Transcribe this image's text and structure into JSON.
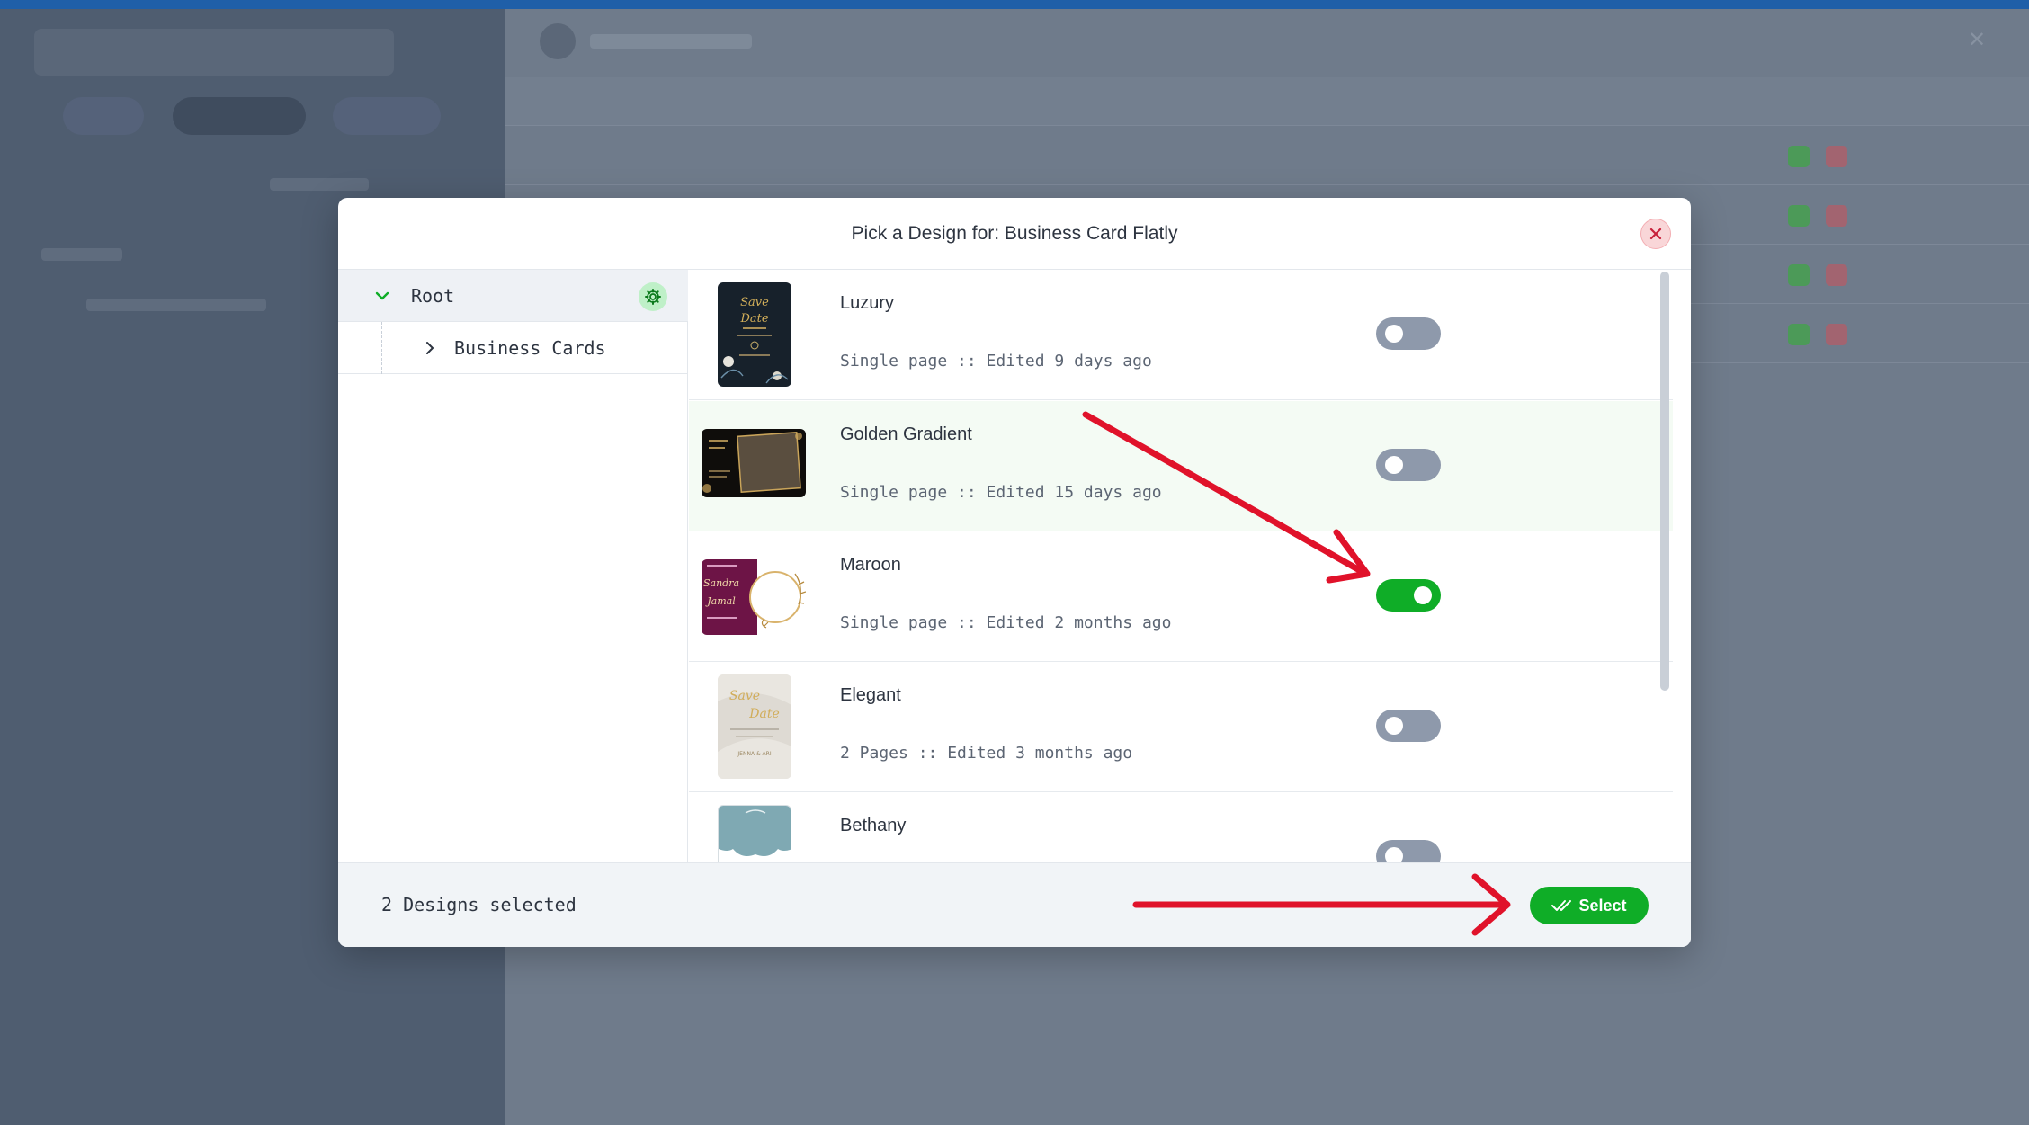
{
  "modal": {
    "title": "Pick a Design for: Business Card Flatly",
    "close_icon": "close-icon"
  },
  "tree": {
    "root_label": "Root",
    "child_label": "Business Cards"
  },
  "designs": [
    {
      "name": "Luzury",
      "meta": "Single page :: Edited 9 days ago",
      "selected": false,
      "thumb_text": "Save the Date"
    },
    {
      "name": "Golden Gradient",
      "meta": "Single page :: Edited 15 days ago",
      "selected": false
    },
    {
      "name": "Maroon",
      "meta": "Single page :: Edited 2 months ago",
      "selected": true,
      "thumb_text_1": "Sandra",
      "thumb_text_2": "Jamal"
    },
    {
      "name": "Elegant",
      "meta": "2 Pages :: Edited 3 months ago",
      "selected": false,
      "thumb_text_1": "Save the Date",
      "thumb_text_2": "JENNA & ARI"
    },
    {
      "name": "Bethany",
      "meta": "",
      "selected": false
    }
  ],
  "footer": {
    "status": "2 Designs selected",
    "select_label": "Select"
  },
  "colors": {
    "accent_green": "#0fad27",
    "annotation_red": "#e0122a",
    "toggle_off": "#8e99ab"
  }
}
